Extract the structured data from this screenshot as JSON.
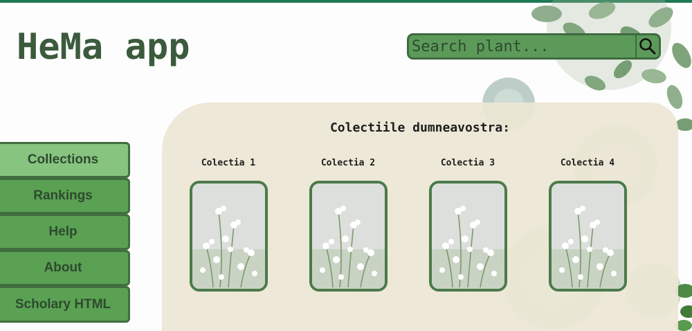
{
  "app": {
    "title": "HeMa app"
  },
  "search": {
    "placeholder": "Search plant...",
    "icon": "search-icon"
  },
  "sidebar": {
    "items": [
      {
        "label": "Collections",
        "active": true
      },
      {
        "label": "Rankings",
        "active": false
      },
      {
        "label": "Help",
        "active": false
      },
      {
        "label": "About",
        "active": false
      },
      {
        "label": "Scholary HTML",
        "active": false
      }
    ]
  },
  "main": {
    "heading": "Colectiile dumneavostra:",
    "collections": [
      {
        "label": "Colectia 1"
      },
      {
        "label": "Colectia 2"
      },
      {
        "label": "Colectia 3"
      },
      {
        "label": "Colectia 4"
      }
    ]
  },
  "colors": {
    "accent": "#1f7a55",
    "button": "#5aa153",
    "button_active": "#86c47f",
    "panel": "#ece6d4",
    "title": "#3c5a3c"
  }
}
